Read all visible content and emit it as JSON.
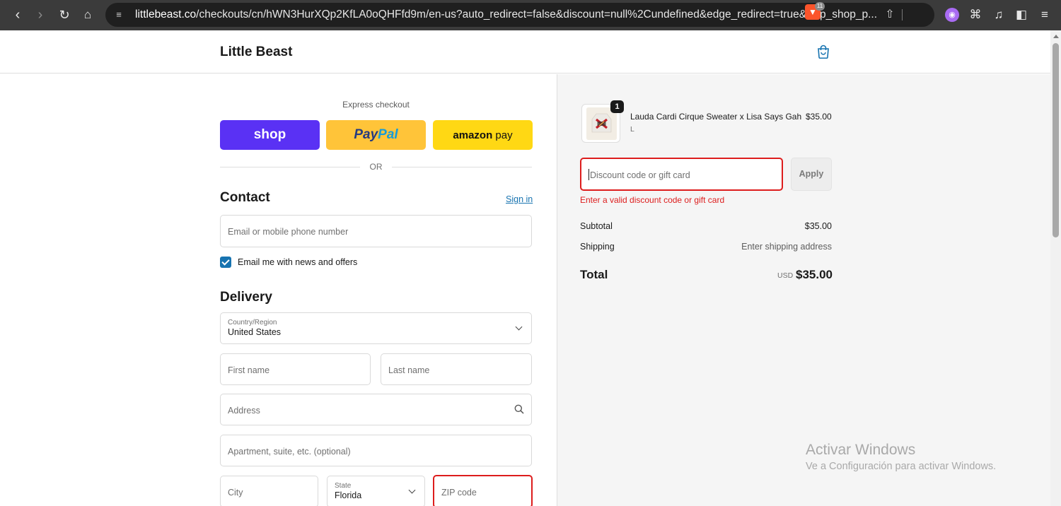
{
  "browser": {
    "url_host": "littlebeast.co",
    "url_path": "/checkouts/cn/hWN3HurXQp2KfLA0oQHFfd9m/en-us?auto_redirect=false&discount=null%2Cundefined&edge_redirect=true&skip_shop_p...",
    "brave_badge": "11",
    "icons": [
      "back-icon",
      "forward-icon",
      "reload-icon",
      "home-icon",
      "site-settings-icon",
      "share-icon",
      "brave-shields-icon",
      "leo-icon",
      "extensions-icon",
      "media-icon",
      "sidebar-icon",
      "menu-icon"
    ]
  },
  "header": {
    "brand": "Little Beast"
  },
  "express": {
    "label": "Express checkout",
    "shop_label": "shop",
    "paypal_pay": "Pay",
    "paypal_pal": "Pal",
    "amazon_label_1": "amazon",
    "amazon_label_2": " pay",
    "or": "OR"
  },
  "contact": {
    "title": "Contact",
    "signin": "Sign in",
    "email_placeholder": "Email or mobile phone number",
    "news_label": "Email me with news and offers",
    "news_checked": true
  },
  "delivery": {
    "title": "Delivery",
    "country_label": "Country/Region",
    "country_value": "United States",
    "first_name_placeholder": "First name",
    "last_name_placeholder": "Last name",
    "address_placeholder": "Address",
    "apartment_placeholder": "Apartment, suite, etc. (optional)",
    "city_placeholder": "City",
    "state_label": "State",
    "state_value": "Florida",
    "zip_placeholder": "ZIP code"
  },
  "order": {
    "item": {
      "quantity": "1",
      "name": "Lauda Cardi Cirque Sweater x Lisa Says Gah",
      "variant": "L",
      "price": "$35.00"
    },
    "discount_placeholder": "Discount code or gift card",
    "apply_label": "Apply",
    "discount_error": "Enter a valid discount code or gift card",
    "subtotal_label": "Subtotal",
    "subtotal_value": "$35.00",
    "shipping_label": "Shipping",
    "shipping_value": "Enter shipping address",
    "total_label": "Total",
    "total_currency": "USD",
    "total_value": "$35.00"
  },
  "watermark": {
    "line1": "Activar Windows",
    "line2": "Ve a Configuración para activar Windows."
  },
  "colors": {
    "shop": "#5a31f4",
    "paypal": "#ffc439",
    "amazon": "#ffd814",
    "link": "#1773b0",
    "error": "#dd1d1d"
  }
}
